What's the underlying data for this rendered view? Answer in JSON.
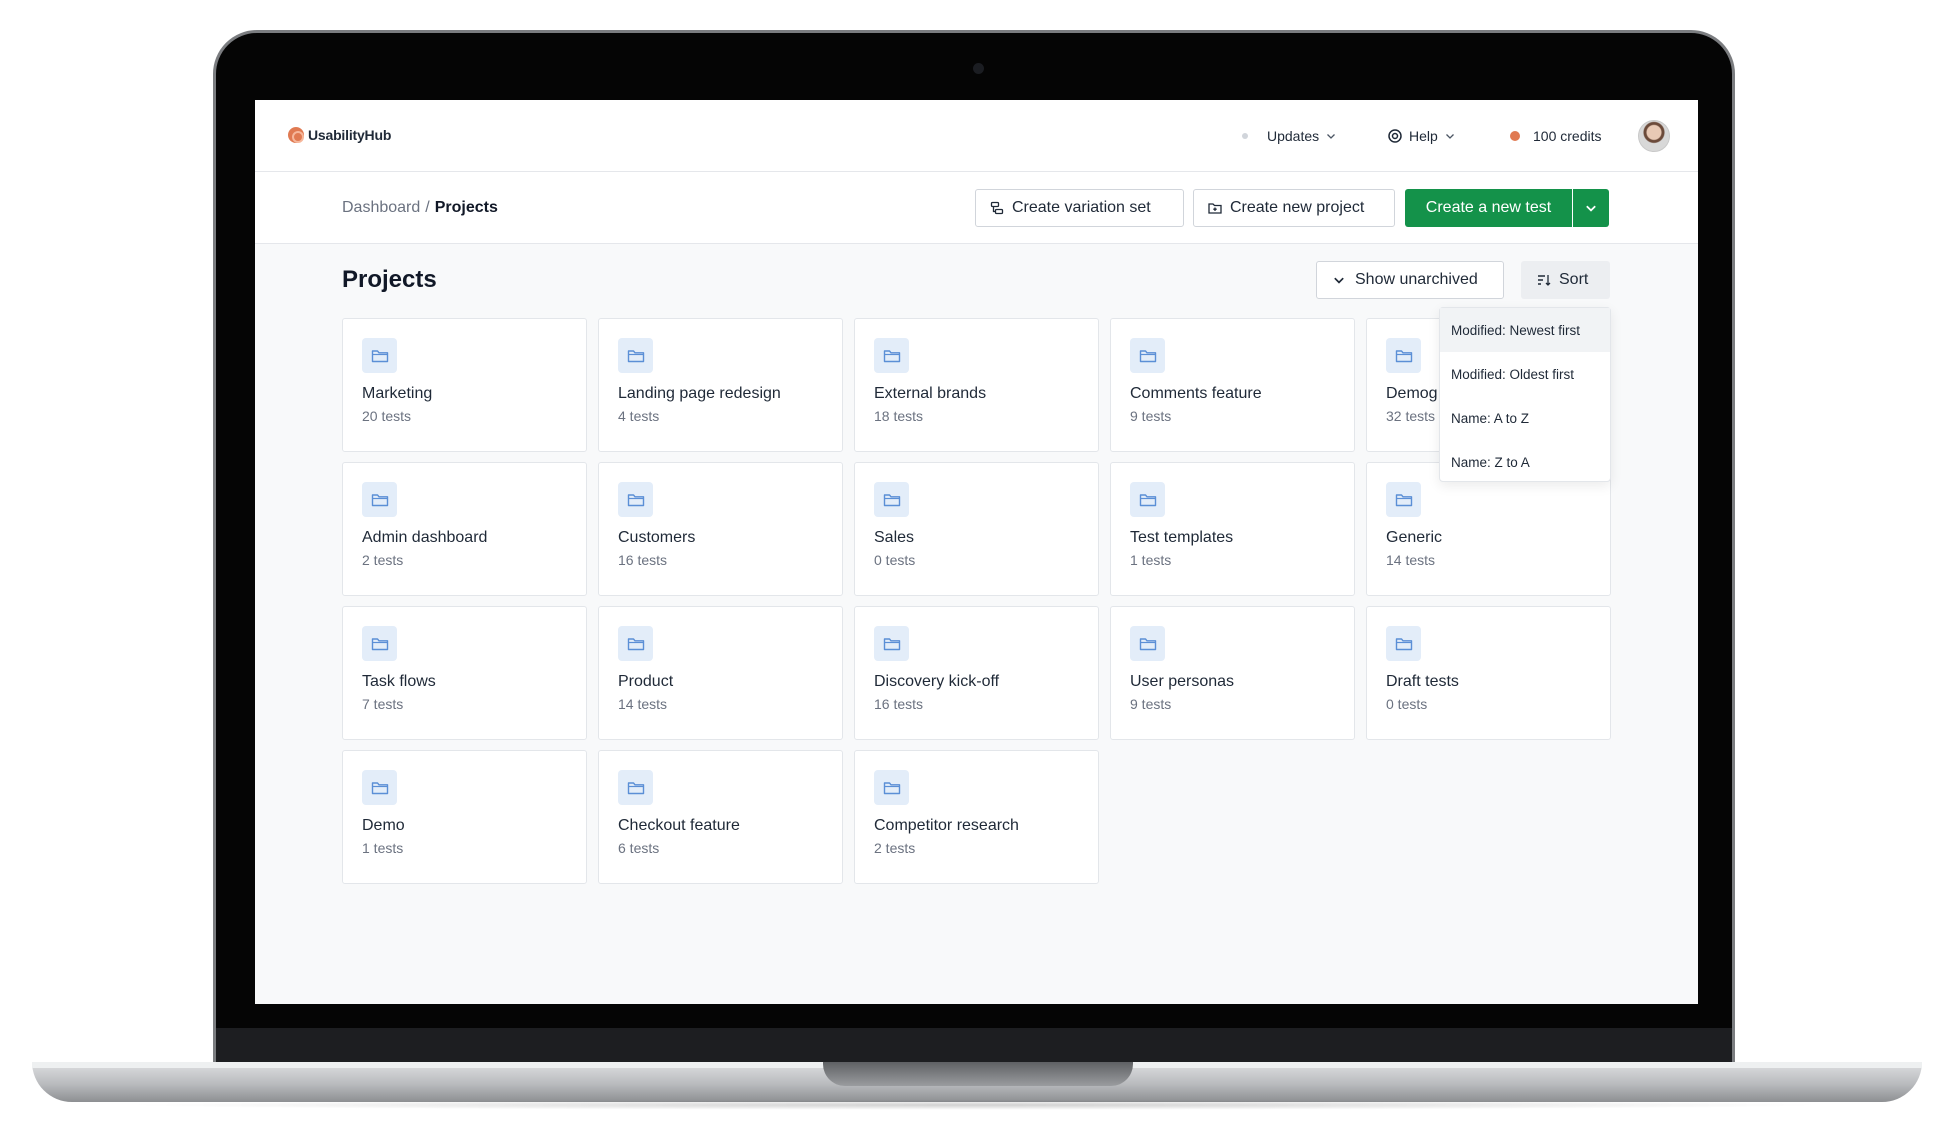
{
  "app": {
    "name": "UsabilityHub"
  },
  "topbar": {
    "updates_label": "Updates",
    "help_label": "Help",
    "credits_label": "100 credits"
  },
  "breadcrumb": {
    "parent": "Dashboard",
    "separator": "/",
    "current": "Projects"
  },
  "actions": {
    "create_variation_set": "Create variation set",
    "create_new_project": "Create new project",
    "create_new_test": "Create a new test"
  },
  "page": {
    "title": "Projects",
    "show_unarchived": "Show unarchived",
    "sort": "Sort"
  },
  "sort_menu": {
    "options": [
      "Modified: Newest first",
      "Modified: Oldest first",
      "Name: A to Z",
      "Name: Z to A"
    ],
    "selected": "Modified: Newest first"
  },
  "projects": [
    {
      "name": "Marketing",
      "count": "20 tests"
    },
    {
      "name": "Landing page redesign",
      "count": "4 tests"
    },
    {
      "name": "External brands",
      "count": "18 tests"
    },
    {
      "name": "Comments feature",
      "count": "9 tests"
    },
    {
      "name": "Demog",
      "count": "32 tests"
    },
    {
      "name": "Admin dashboard",
      "count": "2 tests"
    },
    {
      "name": "Customers",
      "count": "16 tests"
    },
    {
      "name": "Sales",
      "count": "0 tests"
    },
    {
      "name": "Test templates",
      "count": "1 tests"
    },
    {
      "name": "Generic",
      "count": "14 tests"
    },
    {
      "name": "Task flows",
      "count": "7 tests"
    },
    {
      "name": "Product",
      "count": "14 tests"
    },
    {
      "name": "Discovery kick-off",
      "count": "16 tests"
    },
    {
      "name": "User personas",
      "count": "9 tests"
    },
    {
      "name": "Draft tests",
      "count": "0 tests"
    },
    {
      "name": "Demo",
      "count": "1 tests"
    },
    {
      "name": "Checkout feature",
      "count": "6 tests"
    },
    {
      "name": "Competitor research",
      "count": "2 tests"
    }
  ],
  "colors": {
    "primary_green": "#14924a",
    "brand_orange": "#e07a52",
    "folder_bg": "#e3edf9",
    "folder_icon": "#5b8fd6"
  }
}
